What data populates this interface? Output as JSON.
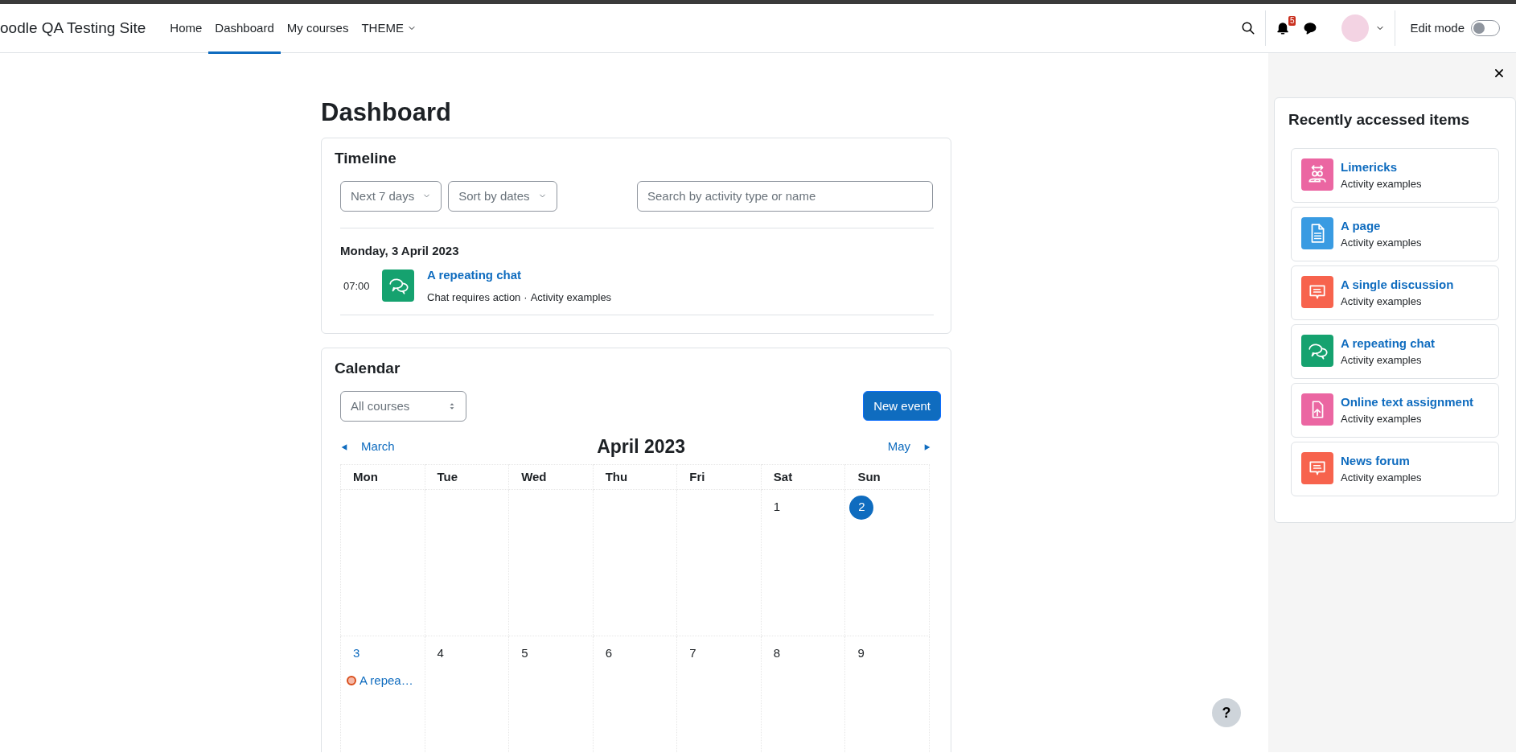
{
  "navbar": {
    "brand": "oodle QA Testing Site",
    "items": [
      {
        "label": "Home",
        "selected": false,
        "dropdown": false
      },
      {
        "label": "Dashboard",
        "selected": true,
        "dropdown": false
      },
      {
        "label": "My courses",
        "selected": false,
        "dropdown": false
      },
      {
        "label": "THEME",
        "selected": false,
        "dropdown": true
      }
    ],
    "notification_count": "5",
    "edit_mode": {
      "label": "Edit mode",
      "on": false
    }
  },
  "page_title": "Dashboard",
  "timeline": {
    "title": "Timeline",
    "filters": [
      "Next 7 days",
      "Sort by dates"
    ],
    "search": {
      "placeholder": "Search by activity type or name"
    },
    "groups": [
      {
        "date": "Monday, 3 April 2023",
        "events": [
          {
            "time": "07:00",
            "kind": "chat",
            "title": "A repeating chat",
            "action": "Chat requires action",
            "separator": "·",
            "course": "Activity examples"
          }
        ]
      }
    ]
  },
  "calendar": {
    "title": "Calendar",
    "course_select": "All courses",
    "new_event": "New event",
    "prev": "March",
    "month": "April 2023",
    "next": "May",
    "weekdays": [
      "Mon",
      "Tue",
      "Wed",
      "Thu",
      "Fri",
      "Sat",
      "Sun"
    ],
    "weeks": [
      [
        {
          "kind": "blank"
        },
        {
          "kind": "blank"
        },
        {
          "kind": "blank"
        },
        {
          "kind": "blank"
        },
        {
          "kind": "blank"
        },
        {
          "kind": "day",
          "day": "1",
          "today": false
        },
        {
          "kind": "day",
          "day": "2",
          "today": true
        }
      ],
      [
        {
          "kind": "day",
          "day": "3",
          "today": false,
          "events": [
            "A repea…"
          ]
        },
        {
          "kind": "day",
          "day": "4",
          "today": false
        },
        {
          "kind": "day",
          "day": "5",
          "today": false
        },
        {
          "kind": "day",
          "day": "6",
          "today": false
        },
        {
          "kind": "day",
          "day": "7",
          "today": false
        },
        {
          "kind": "day",
          "day": "8",
          "today": false
        },
        {
          "kind": "day",
          "day": "9",
          "today": false
        }
      ]
    ]
  },
  "help": "?",
  "drawer": {
    "title": "Recently accessed items",
    "items": [
      {
        "kind": "people",
        "title": "Limericks",
        "course": "Activity examples"
      },
      {
        "kind": "page",
        "title": "A page",
        "course": "Activity examples"
      },
      {
        "kind": "forum",
        "title": "A single discussion",
        "course": "Activity examples"
      },
      {
        "kind": "chat",
        "title": "A repeating chat",
        "course": "Activity examples"
      },
      {
        "kind": "assign",
        "title": "Online text assignment",
        "course": "Activity examples"
      },
      {
        "kind": "forum",
        "title": "News forum",
        "course": "Activity examples"
      }
    ]
  }
}
